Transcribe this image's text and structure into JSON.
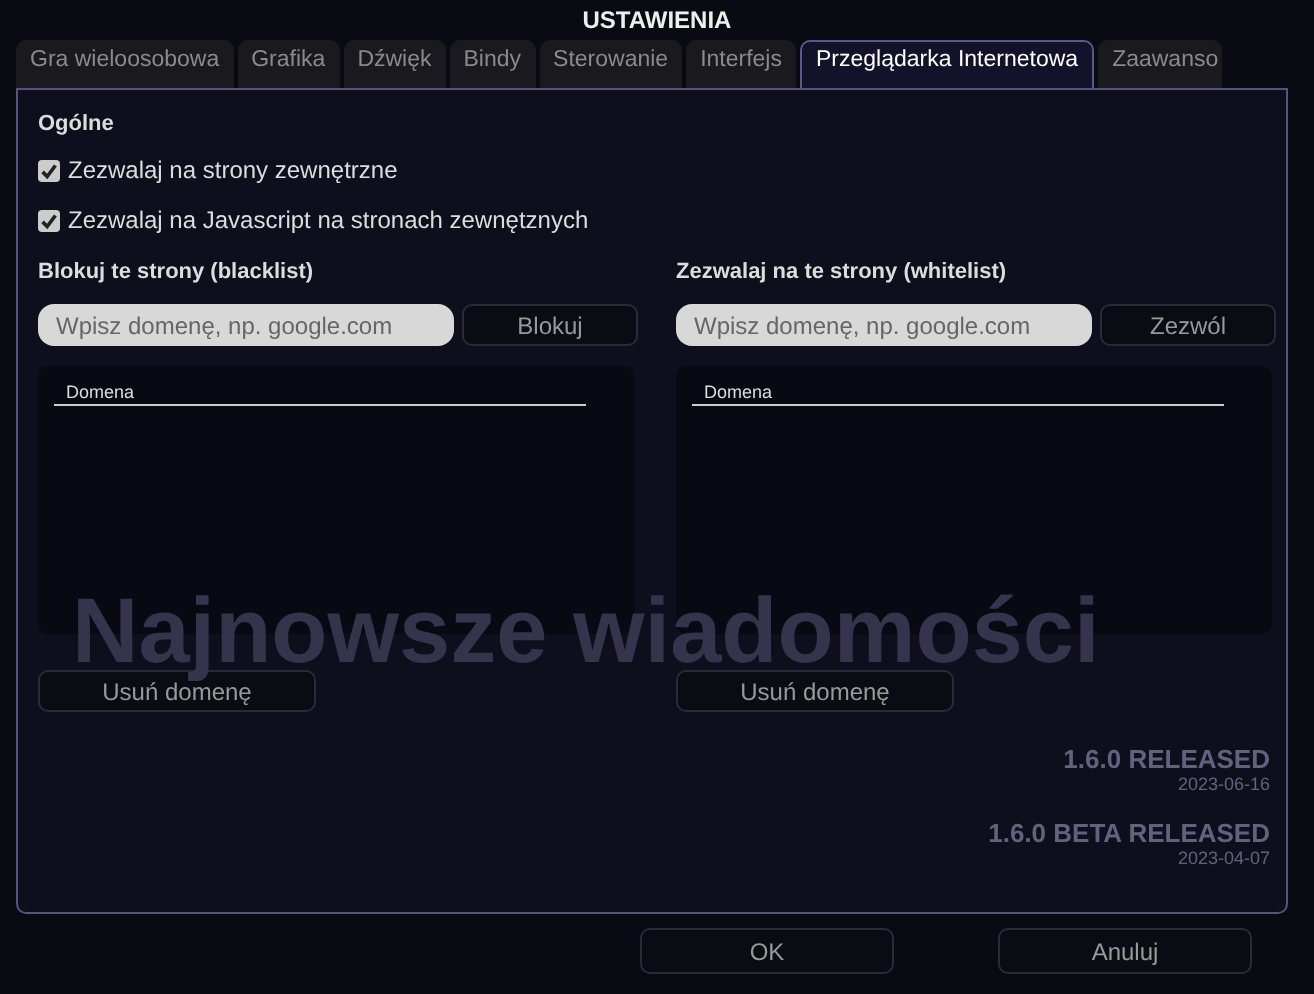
{
  "window": {
    "title": "USTAWIENIA"
  },
  "background": {
    "headline": "Najnowsze wiadomości",
    "news": [
      {
        "title": "1.6.0 RELEASED",
        "date": "2023-06-16"
      },
      {
        "title": "1.6.0 BETA RELEASED",
        "date": "2023-04-07"
      }
    ]
  },
  "tabs": [
    {
      "label": "Gra wieloosobowa",
      "selected": false
    },
    {
      "label": "Grafika",
      "selected": false
    },
    {
      "label": "Dźwięk",
      "selected": false
    },
    {
      "label": "Bindy",
      "selected": false
    },
    {
      "label": "Sterowanie",
      "selected": false
    },
    {
      "label": "Interfejs",
      "selected": false
    },
    {
      "label": "Przeglądarka Internetowa",
      "selected": true
    },
    {
      "label": "Zaawanso",
      "selected": false
    }
  ],
  "general": {
    "heading": "Ogólne",
    "options": [
      {
        "label": "Zezwalaj na strony zewnętrzne",
        "checked": true
      },
      {
        "label": "Zezwalaj na Javascript na stronach zewnętznych",
        "checked": true
      }
    ]
  },
  "lists": [
    {
      "heading": "Blokuj te strony (blacklist)",
      "placeholder": "Wpisz domenę, np. google.com",
      "add_button": "Blokuj",
      "column": "Domena",
      "remove_button": "Usuń domenę"
    },
    {
      "heading": "Zezwalaj na te strony (whitelist)",
      "placeholder": "Wpisz domenę, np. google.com",
      "add_button": "Zezwól",
      "column": "Domena",
      "remove_button": "Usuń domenę"
    }
  ],
  "buttons": [
    "OK",
    "Anuluj"
  ]
}
